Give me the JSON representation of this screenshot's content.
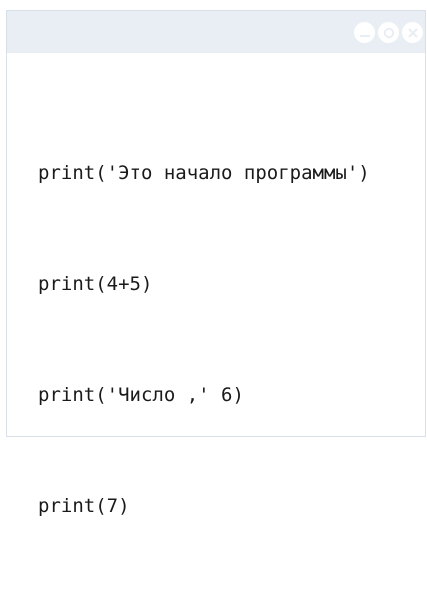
{
  "window": {
    "controls": [
      {
        "icon": "minimize-icon"
      },
      {
        "icon": "maximize-icon"
      },
      {
        "icon": "close-icon"
      }
    ]
  },
  "editor": {
    "lines": [
      "print('Это начало программы')",
      "print(4+5)",
      "print('Число ,' 6)",
      "print(7)"
    ]
  },
  "colors": {
    "titlebar": "#e9eef5",
    "border": "#d8dfe8",
    "control": "#ffffff",
    "text": "#1a1a1a"
  }
}
